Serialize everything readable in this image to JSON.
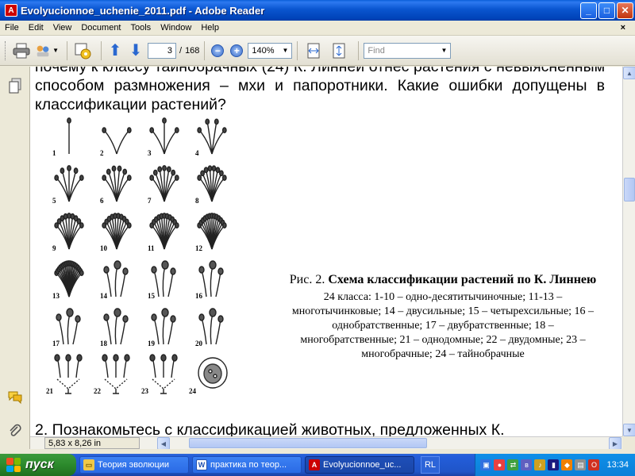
{
  "window": {
    "title": "Evolyucionnoe_uchenie_2011.pdf - Adobe Reader",
    "minimize": "_",
    "maximize": "□",
    "close": "✕"
  },
  "menu": {
    "items": [
      "File",
      "Edit",
      "View",
      "Document",
      "Tools",
      "Window",
      "Help"
    ],
    "close_doc": "×"
  },
  "toolbar": {
    "current_page": "3",
    "page_sep": "/",
    "total_pages": "168",
    "zoom": "140%",
    "find_placeholder": "Find"
  },
  "document": {
    "para_top": "почему к классу тайнобрачных (24) К. Линней отнес растения с невыясненным способом размножения – мхи и папоротники. Какие ошибки допущены в классификации растений?",
    "figure_numbers": [
      "1",
      "2",
      "3",
      "4",
      "5",
      "6",
      "7",
      "8",
      "9",
      "10",
      "11",
      "12",
      "13",
      "14",
      "15",
      "16",
      "17",
      "18",
      "19",
      "20",
      "21",
      "22",
      "23",
      "24"
    ],
    "caption_prefix": "Рис. 2. ",
    "caption_title": "Схема классификации растений по К. Линнею",
    "caption_desc": "24 класса: 1-10 – одно-десятитычиночные; 11-13 – многотычинковые; 14 – двусильные; 15 – четырехсильные; 16 – однобратственные; 17 – двубратственные; 18 – многобратственные; 21 – однодомные; 22 – двудомные; 23 – многобрачные; 24 – тайнобрачные",
    "para_bottom": "2. Познакомьтесь с классификацией животных, предложенных К."
  },
  "statusbar": {
    "page_size": "5,83 x 8,26 in"
  },
  "taskbar": {
    "start_label": "пуск",
    "tasks": [
      {
        "label": "Теория эволюции",
        "icon": "folder-icon"
      },
      {
        "label": "практика по теор...",
        "icon": "word-icon"
      },
      {
        "label": "Evolyucionnoe_uc...",
        "icon": "pdf-icon"
      }
    ],
    "language": "RL",
    "clock": "13:34"
  }
}
